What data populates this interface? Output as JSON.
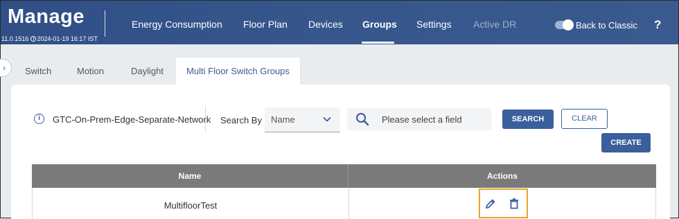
{
  "header": {
    "brand": "Manage",
    "version": "11.0.1516",
    "datetime": "2024-01-19 16:17 IST",
    "nav": [
      "Energy Consumption",
      "Floor Plan",
      "Devices",
      "Groups",
      "Settings",
      "Active DR"
    ],
    "active_nav": "Groups",
    "classic_label": "Back to Classic",
    "help": "?"
  },
  "tabs": [
    "Switch",
    "Motion",
    "Daylight",
    "Multi Floor Switch Groups"
  ],
  "active_tab": "Multi Floor Switch Groups",
  "filters": {
    "network": "GTC-On-Prem-Edge-Separate-Network",
    "search_by_label": "Search By",
    "search_by_value": "Name",
    "search_placeholder": "Please select a field",
    "search_button": "SEARCH",
    "clear_button": "CLEAR",
    "create_button": "CREATE"
  },
  "table": {
    "columns": [
      "Name",
      "Actions"
    ],
    "rows": [
      {
        "name": "MultifloorTest"
      }
    ]
  },
  "colors": {
    "header": "#36568c",
    "primary": "#3b5f9c",
    "highlight": "#e5a32c",
    "table_header": "#7a7a7a"
  }
}
